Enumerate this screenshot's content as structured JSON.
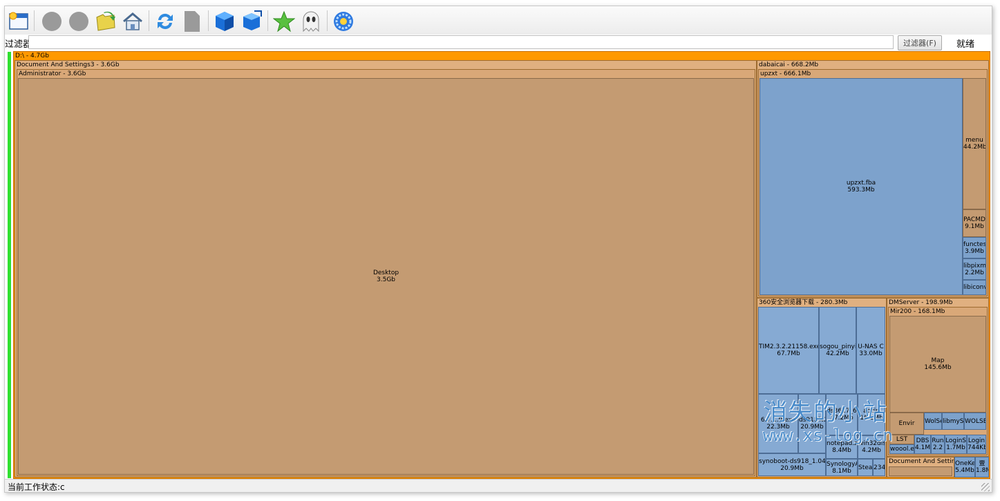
{
  "toolbar": {
    "buttons": [
      {
        "name": "new-window-icon"
      },
      {
        "name": "back-icon"
      },
      {
        "name": "forward-icon"
      },
      {
        "name": "folder-open-icon"
      },
      {
        "name": "home-icon"
      },
      {
        "name": "refresh-icon"
      },
      {
        "name": "document-icon"
      },
      {
        "name": "cube-icon"
      },
      {
        "name": "cube-expand-icon"
      },
      {
        "name": "star-icon"
      },
      {
        "name": "ghost-icon"
      },
      {
        "name": "settings-flower-icon"
      }
    ]
  },
  "filter": {
    "label": "过滤器",
    "value": "",
    "button_label": "过滤器(F)",
    "status": "就绪"
  },
  "treemap": {
    "root": "D:\\ - 4.7Gb",
    "doc_settings": "Document And Settings3 - 3.6Gb",
    "administrator": "Administrator - 3.6Gb",
    "desktop_name": "Desktop",
    "desktop_size": "3.5Gb",
    "dabaicai": "dabaicai - 668.2Mb",
    "upzxt": "upzxt - 666.1Mb",
    "upzxt_fba_name": "upzxt.fba",
    "upzxt_fba_size": "593.3Mb",
    "menu_name": "menu",
    "menu_size": "44.2Mb",
    "pacmd_name": "PACMD",
    "pacmd_size": "9.1Mb",
    "functest_name": "functest",
    "functest_size": "3.9Mb",
    "libpixma_name": "libpixma",
    "libpixma_size": "2.2Mb",
    "libiconv_name": "libiconv2",
    "dl360": "360安全浏览器下载 - 280.3Mb",
    "tim_name": "TIM2.3.2.21158.exe",
    "tim_size": "67.7Mb",
    "sogou_name": "sogou_pinyin",
    "sogou_size": "42.2Mb",
    "unas_name": "U-NAS C",
    "unas_size": "33.0Mb",
    "v671_name": "6.7.1.9.exe",
    "v671_size": "22.3Mb",
    "ds918_name": "ds918%2",
    "ds918_size": "20.9Mb",
    "ds17_name": "ds3617_6",
    "ds17_size": "17.2Mb",
    "aozip_name": "aozip",
    "aozip_size": "16.1Mb",
    "notepad_name": "notepad.zi",
    "notepad_size": "8.4Mb",
    "win32_name": "win32dis",
    "win32_size": "4.2Mb",
    "synoboot_name": "synoboot-ds918_1.04a",
    "synoboot_size": "20.9Mb",
    "synology_name": "SynologyA",
    "synology_size": "8.1Mb",
    "stea_name": "Stea",
    "n234_name": "234",
    "dmserver": "DMServer - 198.9Mb",
    "mir200": "Mir200 - 168.1Mb",
    "map_name": "Map",
    "map_size": "145.6Mb",
    "envir_name": "Envir",
    "wols_name": "WolSe",
    "libmys_name": "libmyS",
    "wolse2_name": "WOLSE",
    "lst_name": "LST",
    "woool_name": "woool.e",
    "dbs_name": "DBS",
    "dbs_size": "4.1M",
    "run_name": "Run",
    "run_size": "2.2",
    "logins_name": "LoginS",
    "logins_size": "1.7Mb",
    "logind_name": "Login",
    "logind_size": "744Kb",
    "doc_settings2": "Document And Setting",
    "oneke_name": "OneKe",
    "oneke_size": "5.4Mb",
    "x_name": "壹",
    "x_size": "1.8M"
  },
  "watermark": {
    "line1": "消失的小站",
    "line2": "www.xs-log.cn"
  },
  "statusbar": {
    "text": "当前工作状态:c"
  },
  "colors": {
    "root_header": "#ff9900",
    "folder": "#c49b72",
    "file": "#7da2cc",
    "highlight": "#30e030"
  }
}
